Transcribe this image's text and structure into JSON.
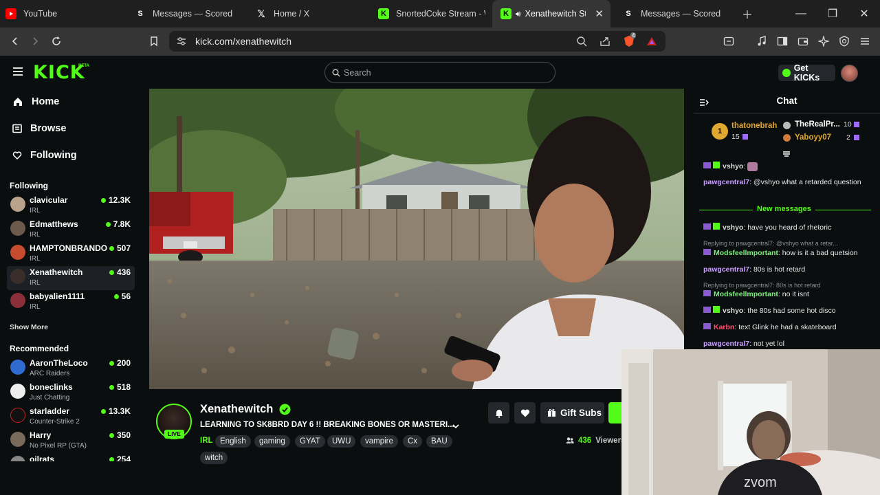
{
  "browser": {
    "tabs": [
      {
        "title": "YouTube",
        "icon": "youtube-icon",
        "active": false
      },
      {
        "title": "Messages — Scored",
        "icon": "scored-icon",
        "active": false
      },
      {
        "title": "Home / X",
        "icon": "x-icon",
        "active": false
      },
      {
        "title": "SnortedCoke Stream - W",
        "icon": "kick-icon",
        "active": false
      },
      {
        "title": "Xenathewitch St",
        "icon": "kick-icon",
        "active": true
      },
      {
        "title": "Messages — Scored",
        "icon": "scored-icon",
        "active": false
      }
    ],
    "url": "kick.com/xenathewitch",
    "shield_badge": "4"
  },
  "kick": {
    "logo": "KICK",
    "beta": "BETA",
    "search_placeholder": "Search",
    "get_kicks": "Get KICKs",
    "accent": "#53fc18"
  },
  "sidebar": {
    "nav": [
      {
        "label": "Home",
        "icon": "home-icon"
      },
      {
        "label": "Browse",
        "icon": "browse-icon"
      },
      {
        "label": "Following",
        "icon": "heart-icon"
      }
    ],
    "following_title": "Following",
    "following": [
      {
        "name": "clavicular",
        "category": "IRL",
        "viewers": "12.3K"
      },
      {
        "name": "Edmatthews",
        "category": "IRL",
        "viewers": "7.8K"
      },
      {
        "name": "HAMPTONBRANDO",
        "category": "IRL",
        "viewers": "507"
      },
      {
        "name": "Xenathewitch",
        "category": "IRL",
        "viewers": "436"
      },
      {
        "name": "babyalien1111",
        "category": "IRL",
        "viewers": "56"
      }
    ],
    "show_more": "Show More",
    "recommended_title": "Recommended",
    "recommended": [
      {
        "name": "AaronTheLoco",
        "category": "ARC Raiders",
        "viewers": "200"
      },
      {
        "name": "boneclinks",
        "category": "Just Chatting",
        "viewers": "518"
      },
      {
        "name": "starladder",
        "category": "Counter-Strike 2",
        "viewers": "13.3K"
      },
      {
        "name": "Harry",
        "category": "No Pixel RP (GTA)",
        "viewers": "350"
      },
      {
        "name": "oilrats",
        "category": "",
        "viewers": "254"
      }
    ]
  },
  "stream": {
    "channel": "Xenathewitch",
    "live_badge": "LIVE",
    "title": "LEARNING TO SK8BRD DAY 6 !! BREAKING BONES OR MASTERI...",
    "category": "IRL",
    "tags": [
      "English",
      "gaming",
      "GYAT",
      "UWU",
      "vampire",
      "Cx",
      "BAU",
      "witch"
    ],
    "gift_subs": "Gift Subs",
    "viewers": "436",
    "viewers_label": "Viewers"
  },
  "chat": {
    "title": "Chat",
    "leaderboard": [
      {
        "rank": "1",
        "name": "thatonebrah",
        "count": "15"
      },
      {
        "name": "TheRealPr...",
        "count": "10"
      },
      {
        "name": "Yaboyy07",
        "count": "2"
      }
    ],
    "new_messages": "New messages",
    "messages": [
      {
        "user": "vshyo",
        "color": "#dcdcdc",
        "text": ""
      },
      {
        "user": "pawgcentral7",
        "color": "#c9a0ff",
        "text": "@vshyo what a retarded question"
      },
      {
        "user": "vshyo",
        "color": "#dcdcdc",
        "text": "have you heard of rhetoric"
      },
      {
        "user": "Modsfeellmportant",
        "color": "#7cf07c",
        "text": "how is it a bad quetsion",
        "reply": "Replying to pawgcentral7: @vshyo what a retar..."
      },
      {
        "user": "pawgcentral7",
        "color": "#c9a0ff",
        "text": "80s is hot retard"
      },
      {
        "user": "Modsfeellmportant",
        "color": "#7cf07c",
        "text": "no it isnt",
        "reply": "Replying to pawgcentral7: 80s is hot retard"
      },
      {
        "user": "vshyo",
        "color": "#dcdcdc",
        "text": "the 80s had some hot disco"
      },
      {
        "user": "Karbn",
        "color": "#ff4f6d",
        "text": "text Glink he had a skateboard"
      },
      {
        "user": "pawgcentral7",
        "color": "#c9a0ff",
        "text": "not yet lol"
      }
    ]
  }
}
